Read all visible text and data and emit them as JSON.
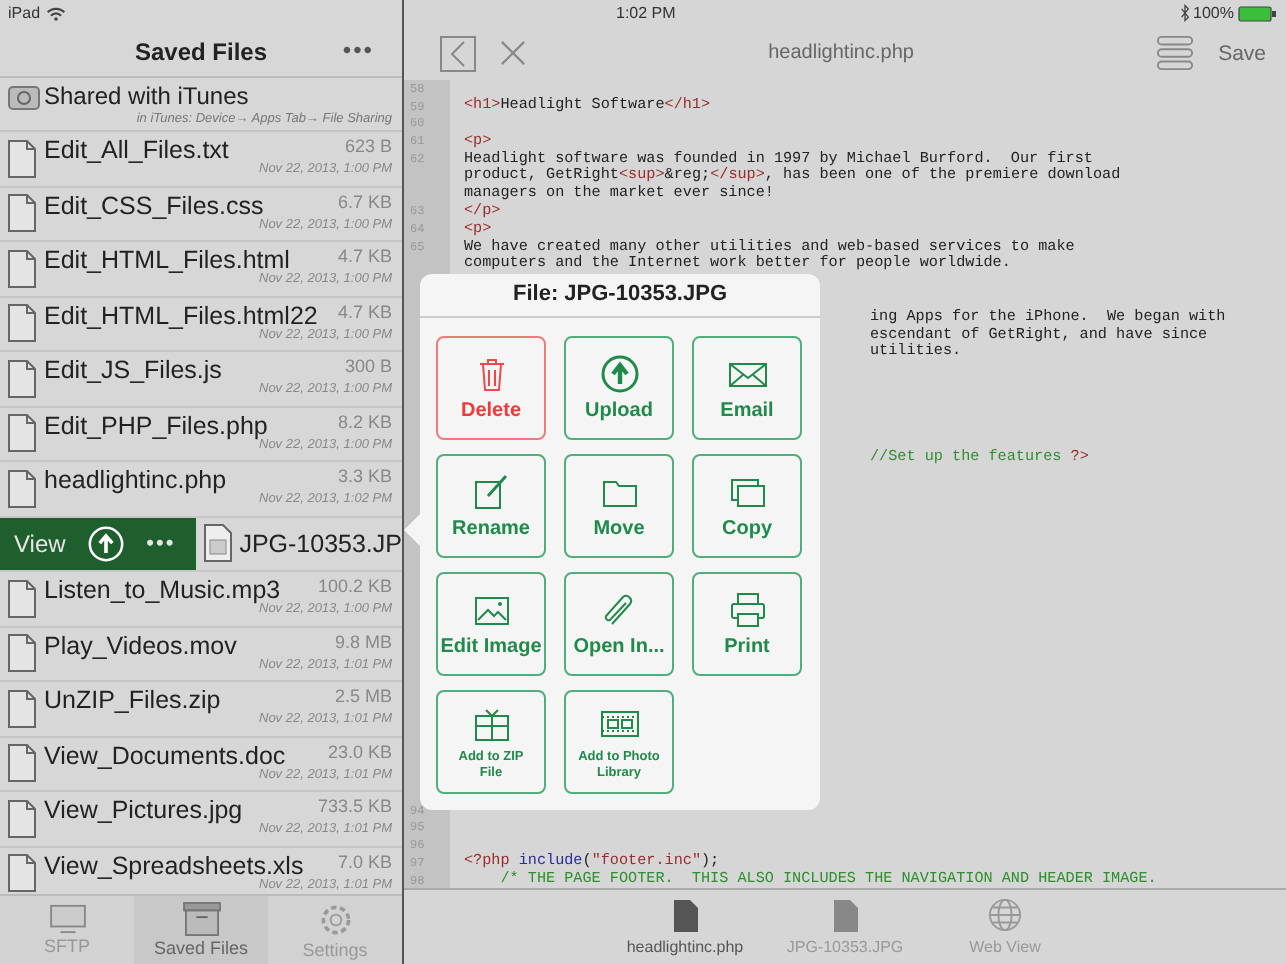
{
  "status_bar": {
    "device": "iPad",
    "time": "1:02 PM",
    "battery": "100%"
  },
  "sidebar": {
    "title": "Saved Files",
    "more": "•••",
    "shared": {
      "name": "Shared with iTunes",
      "hint": "in iTunes: Device→ Apps Tab→ File Sharing"
    },
    "files": [
      {
        "name": "Edit_All_Files.txt",
        "size": "623 B",
        "date": "Nov 22, 2013, 1:00 PM",
        "swiped": false
      },
      {
        "name": "Edit_CSS_Files.css",
        "size": "6.7 KB",
        "date": "Nov 22, 2013, 1:00 PM",
        "swiped": false
      },
      {
        "name": "Edit_HTML_Files.html",
        "size": "4.7 KB",
        "date": "Nov 22, 2013, 1:00 PM",
        "swiped": false
      },
      {
        "name": "Edit_HTML_Files.html22",
        "size": "4.7 KB",
        "date": "Nov 22, 2013, 1:00 PM",
        "swiped": false
      },
      {
        "name": "Edit_JS_Files.js",
        "size": "300 B",
        "date": "Nov 22, 2013, 1:00 PM",
        "swiped": false
      },
      {
        "name": "Edit_PHP_Files.php",
        "size": "8.2 KB",
        "date": "Nov 22, 2013, 1:00 PM",
        "swiped": false
      },
      {
        "name": "headlightinc.php",
        "size": "3.3 KB",
        "date": "Nov 22, 2013, 1:02 PM",
        "swiped": false
      },
      {
        "name": "JPG-10353.JP",
        "swiped": true
      },
      {
        "name": "Listen_to_Music.mp3",
        "size": "100.2 KB",
        "date": "Nov 22, 2013, 1:00 PM",
        "swiped": false
      },
      {
        "name": "Play_Videos.mov",
        "size": "9.8 MB",
        "date": "Nov 22, 2013, 1:01 PM",
        "swiped": false
      },
      {
        "name": "UnZIP_Files.zip",
        "size": "2.5 MB",
        "date": "Nov 22, 2013, 1:01 PM",
        "swiped": false
      },
      {
        "name": "View_Documents.doc",
        "size": "23.0 KB",
        "date": "Nov 22, 2013, 1:01 PM",
        "swiped": false
      },
      {
        "name": "View_Pictures.jpg",
        "size": "733.5 KB",
        "date": "Nov 22, 2013, 1:01 PM",
        "swiped": false
      },
      {
        "name": "View_Spreadsheets.xls",
        "size": "7.0 KB",
        "date": "Nov 22, 2013, 1:01 PM",
        "swiped": false
      }
    ],
    "swipe_actions": {
      "view": "View",
      "more": "•••"
    },
    "tabs": [
      {
        "label": "SFTP",
        "selected": false
      },
      {
        "label": "Saved Files",
        "selected": true
      },
      {
        "label": "Settings",
        "selected": false
      }
    ]
  },
  "editor": {
    "title": "headlightinc.php",
    "save": "Save",
    "lines": [
      {
        "kind": "full",
        "num": "58"
      },
      {
        "kind": "full",
        "num": "59",
        "parts": [
          {
            "kind": "tag",
            "text": "<h1>"
          },
          {
            "kind": "plain",
            "text": "Headlight Software"
          },
          {
            "kind": "tag",
            "text": "</h1>"
          }
        ]
      },
      {
        "kind": "full",
        "num": "60"
      },
      {
        "kind": "full",
        "num": "61",
        "parts": [
          {
            "kind": "tag",
            "text": "<p>"
          }
        ]
      },
      {
        "kind": "full",
        "num": "62",
        "parts": [
          {
            "kind": "plain",
            "text": "Headlight software was founded in 1997 by Michael Burford.  Our first"
          }
        ]
      },
      {
        "kind": "full",
        "parts": [
          {
            "kind": "plain",
            "text": "product, GetRight"
          },
          {
            "kind": "tag",
            "text": "<sup>"
          },
          {
            "kind": "plain",
            "text": "&reg;"
          },
          {
            "kind": "tag",
            "text": "</sup>"
          },
          {
            "kind": "plain",
            "text": ", has been one of the premiere download"
          }
        ]
      },
      {
        "kind": "full",
        "parts": [
          {
            "kind": "plain",
            "text": "managers on the market ever since!"
          }
        ]
      },
      {
        "kind": "full",
        "num": "63",
        "parts": [
          {
            "kind": "tag",
            "text": "</p>"
          }
        ]
      },
      {
        "kind": "full",
        "num": "64",
        "parts": [
          {
            "kind": "tag",
            "text": "<p>"
          }
        ]
      },
      {
        "kind": "full",
        "num": "65",
        "parts": [
          {
            "kind": "plain",
            "text": "We have created many other utilities and web-based services to make"
          }
        ]
      },
      {
        "kind": "full",
        "parts": [
          {
            "kind": "plain",
            "text": "computers and the Internet work better for people worldwide."
          }
        ]
      },
      {
        "kind": "covered"
      },
      {
        "kind": "covered"
      },
      {
        "kind": "tail",
        "parts": [
          {
            "kind": "plain",
            "text": "ing Apps for the iPhone.  We began with"
          }
        ]
      },
      {
        "kind": "tail",
        "parts": [
          {
            "kind": "plain",
            "text": "escendant of GetRight, and have since"
          }
        ]
      },
      {
        "kind": "tail",
        "parts": [
          {
            "kind": "plain",
            "text": "utilities."
          }
        ]
      },
      {
        "kind": "covered"
      },
      {
        "kind": "covered"
      },
      {
        "kind": "covered"
      },
      {
        "kind": "covered"
      },
      {
        "kind": "covered"
      },
      {
        "kind": "tail",
        "parts": [
          {
            "kind": "comment",
            "text": "//Set up the features "
          },
          {
            "kind": "tag",
            "text": "?>"
          }
        ]
      },
      {
        "kind": "covered"
      },
      {
        "kind": "covered"
      },
      {
        "kind": "covered"
      },
      {
        "kind": "covered"
      },
      {
        "kind": "covered"
      },
      {
        "kind": "covered"
      },
      {
        "kind": "covered"
      },
      {
        "kind": "covered"
      },
      {
        "kind": "covered"
      },
      {
        "kind": "covered"
      },
      {
        "kind": "covered"
      },
      {
        "kind": "covered"
      },
      {
        "kind": "covered"
      },
      {
        "kind": "covered"
      },
      {
        "kind": "covered"
      },
      {
        "kind": "covered"
      },
      {
        "kind": "covered"
      },
      {
        "kind": "covered"
      },
      {
        "kind": "covered"
      },
      {
        "kind": "full",
        "num": "94"
      },
      {
        "kind": "full",
        "num": "95"
      },
      {
        "kind": "full",
        "num": "96"
      },
      {
        "kind": "full",
        "num": "97",
        "parts": [
          {
            "kind": "tag",
            "text": "<?php "
          },
          {
            "kind": "func",
            "text": "include"
          },
          {
            "kind": "plain",
            "text": "("
          },
          {
            "kind": "tag",
            "text": "\"footer.inc\""
          },
          {
            "kind": "plain",
            "text": ");"
          }
        ]
      },
      {
        "kind": "full",
        "num": "98",
        "parts": [
          {
            "kind": "comment",
            "text": "    /* THE PAGE FOOTER.  THIS ALSO INCLUDES THE NAVIGATION AND HEADER IMAGE."
          }
        ]
      }
    ],
    "tabs": [
      {
        "label": "headlightinc.php",
        "selected": true
      },
      {
        "label": "JPG-10353.JPG",
        "selected": false
      },
      {
        "label": "Web View",
        "selected": false
      }
    ]
  },
  "popover": {
    "title": "File: JPG-10353.JPG",
    "actions": [
      {
        "kind": "delete",
        "label": "Delete"
      },
      {
        "kind": "upload",
        "label": "Upload"
      },
      {
        "kind": "email",
        "label": "Email"
      },
      {
        "kind": "rename",
        "label": "Rename"
      },
      {
        "kind": "move",
        "label": "Move"
      },
      {
        "kind": "copy",
        "label": "Copy"
      },
      {
        "kind": "edit-image",
        "label": "Edit Image"
      },
      {
        "kind": "open-in",
        "label": "Open In..."
      },
      {
        "kind": "print",
        "label": "Print"
      },
      {
        "kind": "zip",
        "label": "Add to ZIP File"
      },
      {
        "kind": "photo",
        "label": "Add to Photo Library"
      }
    ]
  }
}
